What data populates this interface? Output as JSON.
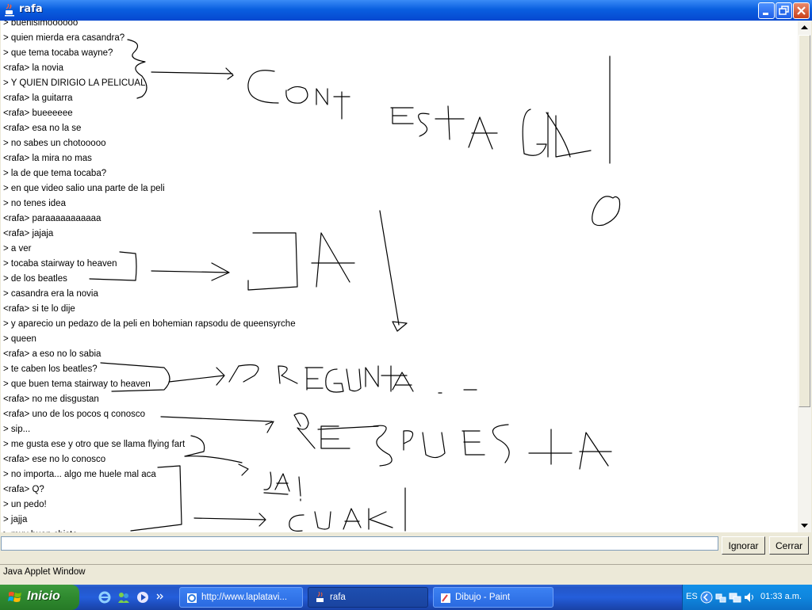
{
  "window": {
    "title": "rafa"
  },
  "chat": {
    "lines": [
      "> buenisimoooooo",
      "> quien mierda era casandra?",
      "> que tema tocaba wayne?",
      "<rafa> la novia",
      "> Y QUIEN DIRIGIO LA PELICUAL",
      "<rafa> la guitarra",
      "<rafa> bueeeeee",
      "<rafa> esa no la se",
      "> no sabes un chotooooo",
      "<rafa> la mira no mas",
      "> la de que tema tocaba?",
      "> en que video salio una parte de la peli",
      "> no tenes idea",
      "<rafa> paraaaaaaaaaaa",
      "<rafa> jajaja",
      "> a ver",
      "> tocaba stairway to heaven",
      "> de los beatles",
      "> casandra era la novia",
      "<rafa> si te lo dije",
      "> y aparecio un pedazo de la peli en bohemian rapsodu de queensyrche",
      "> queen",
      "<rafa> a eso no lo sabia",
      "> te caben los beatles?",
      "> que buen tema stairway to heaven",
      "<rafa> no me disgustan",
      "<rafa> uno de los pocos q conosco",
      "> sip...",
      "> me gusta ese y otro que se llama flying fart",
      "<rafa> ese no lo conosco",
      "> no importa... algo me huele mal aca",
      "<rafa> Q?",
      "> un pedo!",
      "> jajja",
      "> muy buen chiste"
    ]
  },
  "doodles": {
    "contesta": "CONTESTA GIL",
    "o": "O",
    "ja": "JA",
    "pregunta": "PREGUNTA",
    "respuesta": "RESPUESTA",
    "ja2": "JA!",
    "cuak": "CUAK!",
    "ink_color": "#000000"
  },
  "input": {
    "value": "",
    "placeholder": ""
  },
  "buttons": {
    "ignorar": "Ignorar",
    "cerrar": "Cerrar"
  },
  "status": {
    "text": "Java Applet Window"
  },
  "taskbar": {
    "start_label": "Inicio",
    "tasks": [
      {
        "label": "http://www.laplatavi...",
        "icon": "ie-page-icon",
        "active": false
      },
      {
        "label": "rafa",
        "icon": "java-cup-icon",
        "active": true
      },
      {
        "label": "Dibujo - Paint",
        "icon": "paint-icon",
        "active": false
      }
    ],
    "lang": "ES",
    "clock": "01:33 a.m."
  },
  "colors": {
    "titlebar": "#0a5fe0",
    "taskbar": "#245edb",
    "start": "#2f8a2f",
    "tray": "#0f86de"
  }
}
